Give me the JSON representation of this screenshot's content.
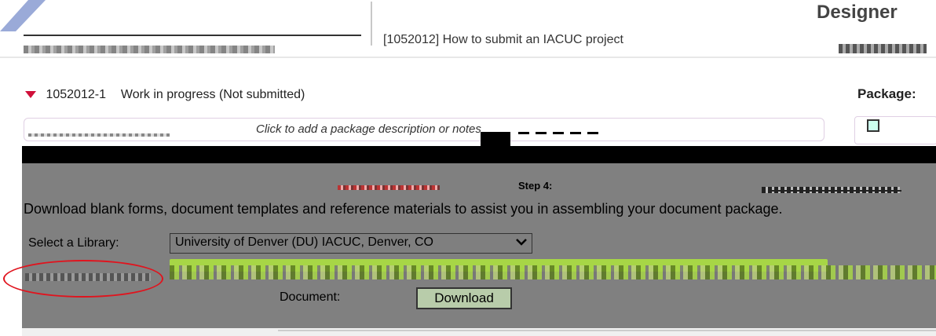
{
  "header": {
    "designer_label": "Designer",
    "howto_title": "[1052012] How to submit an IACUC project"
  },
  "package": {
    "id": "1052012-1",
    "status": "Work in progress (Not submitted)",
    "package_label": "Package:",
    "description_placeholder": "Click to add a package description or notes"
  },
  "tabs": {
    "step_label": "Step 4:"
  },
  "library": {
    "instructions": "Download blank forms, document templates and reference materials to assist you in assembling your document package.",
    "select_label": "Select a Library:",
    "selected": "University of Denver (DU) IACUC, Denver, CO",
    "document_label": "Document:",
    "download_label": "Download"
  },
  "colors": {
    "accent_red": "#d0103a",
    "oval_red": "#e0141e",
    "green_highlight": "#a7d646"
  },
  "icons": [
    "collapse-triangle-icon",
    "chevron-down-icon"
  ]
}
